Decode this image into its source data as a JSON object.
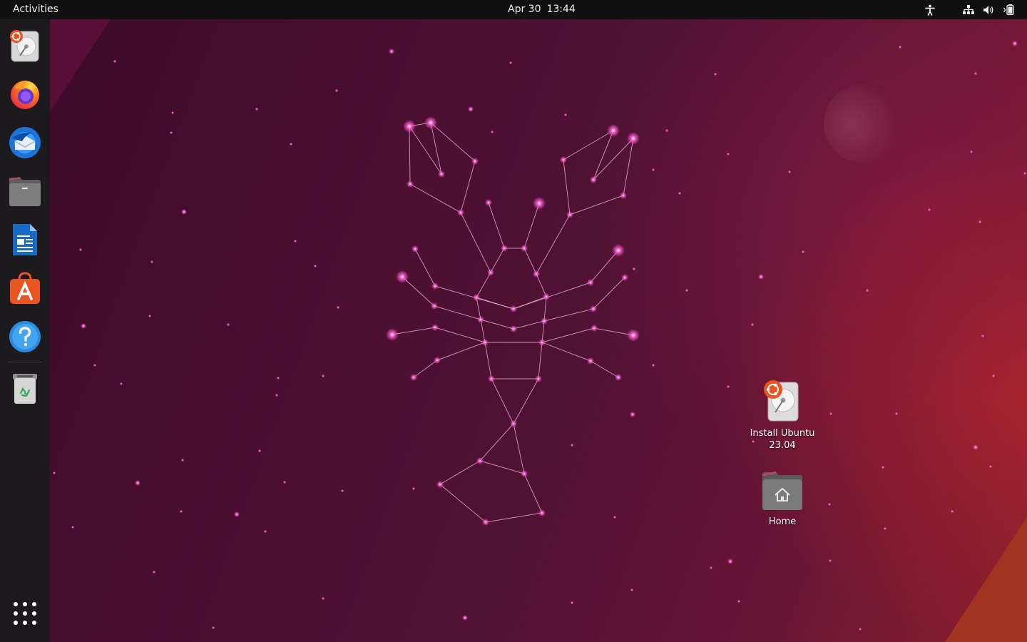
{
  "topbar": {
    "activities_label": "Activities",
    "clock_date": "Apr 30",
    "clock_time": "13:44",
    "tray_icons": [
      "accessibility-icon",
      "network-icon",
      "volume-icon",
      "battery-icon"
    ]
  },
  "dock": {
    "items": [
      {
        "name": "install-ubuntu",
        "icon": "ubuntu-installer-icon"
      },
      {
        "name": "firefox",
        "icon": "firefox-icon"
      },
      {
        "name": "thunderbird",
        "icon": "thunderbird-icon"
      },
      {
        "name": "files",
        "icon": "files-icon"
      },
      {
        "name": "libreoffice-writer",
        "icon": "writer-icon"
      },
      {
        "name": "app-center",
        "icon": "app-center-icon"
      },
      {
        "name": "help",
        "icon": "help-icon"
      },
      {
        "name": "trash",
        "icon": "trash-icon"
      }
    ],
    "show_apps_icon": "app-grid-icon"
  },
  "desktop": {
    "icons": [
      {
        "label_line1": "Install Ubuntu",
        "label_line2": "23.04",
        "icon": "ubuntu-installer-icon"
      },
      {
        "label": "Home",
        "icon": "home-folder-icon"
      }
    ]
  },
  "colors": {
    "accent": "#e95420",
    "topbar": "#111111",
    "dock": "#1c1a1d",
    "constellation": "#f6b6dc",
    "star": "#ff5ad0"
  }
}
